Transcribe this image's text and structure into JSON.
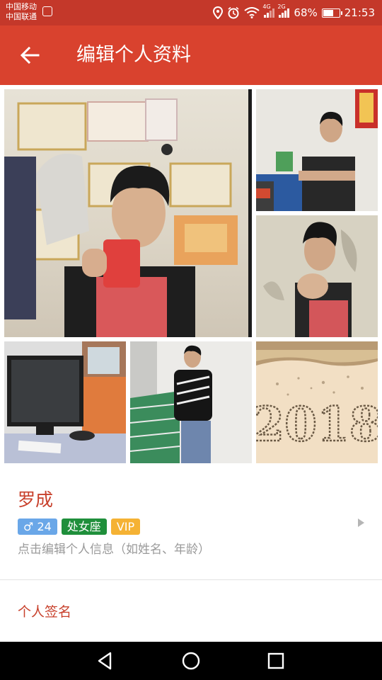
{
  "status_bar": {
    "carrier1": "中国移动",
    "carrier2": "中国联通",
    "net1": "4G",
    "net2": "2G",
    "battery": "68%",
    "battery_level": 0.68,
    "time": "21:53"
  },
  "header": {
    "title": "编辑个人资料",
    "back_icon": "arrow-left-icon",
    "background": "#d9422e"
  },
  "photos": [
    {
      "id": "photo-1"
    },
    {
      "id": "photo-2"
    },
    {
      "id": "photo-3"
    },
    {
      "id": "photo-4"
    },
    {
      "id": "photo-5"
    },
    {
      "id": "photo-6",
      "caption": "2018"
    }
  ],
  "profile": {
    "name": "罗成",
    "gender_symbol": "♂",
    "age": "24",
    "zodiac": "处女座",
    "vip": "VIP",
    "hint": "点击编辑个人信息（如姓名、年龄）",
    "accent_color": "#c8412c"
  },
  "signature": {
    "label": "个人签名"
  },
  "navbar": {
    "icons": [
      "back-triangle-icon",
      "home-circle-icon",
      "recents-square-icon"
    ]
  }
}
